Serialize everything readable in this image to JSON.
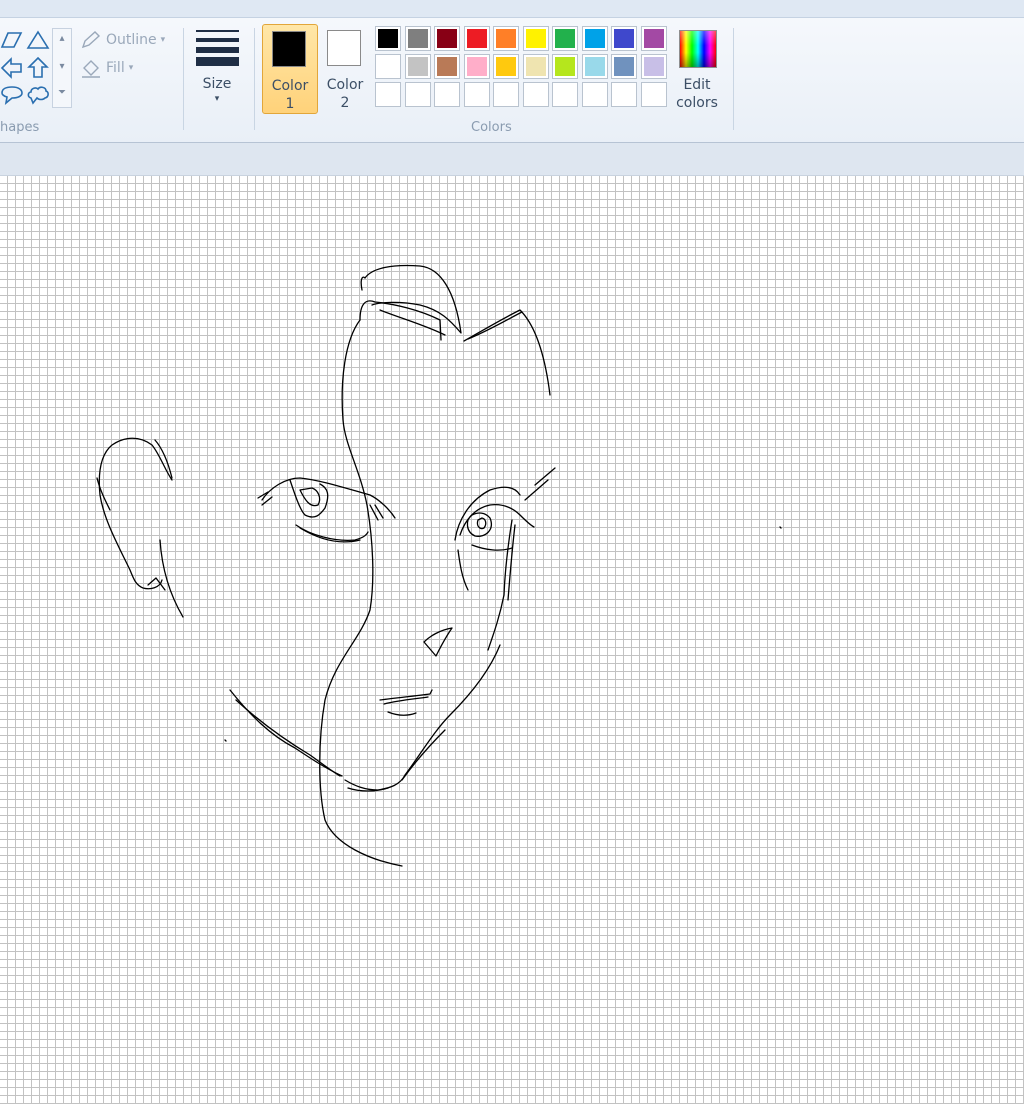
{
  "ribbon": {
    "shapes_group_label": "hapes",
    "outline_label": "Outline",
    "fill_label": "Fill",
    "size_label": "Size",
    "color1_label_line1": "Color",
    "color1_label_line2": "1",
    "color1_value": "#000000",
    "color2_label_line1": "Color",
    "color2_label_line2": "2",
    "color2_value": "#ffffff",
    "colors_group_label": "Colors",
    "edit_colors_line1": "Edit",
    "edit_colors_line2": "colors",
    "palette_row1": [
      "#000000",
      "#7f7f7f",
      "#880015",
      "#ed1c24",
      "#ff7f27",
      "#fff200",
      "#22b14c",
      "#00a2e8",
      "#3f48cc",
      "#a349a4"
    ],
    "palette_row2": [
      "#ffffff",
      "#c3c3c3",
      "#b97a57",
      "#ffaec9",
      "#ffc90e",
      "#efe4b0",
      "#b5e61d",
      "#99d9ea",
      "#7092be",
      "#c8bfe7"
    ],
    "palette_row3": [
      "",
      "",
      "",
      "",
      "",
      "",
      "",
      "",
      "",
      ""
    ]
  },
  "icons": [
    "triangle-shape-icon",
    "polygon-shape-icon",
    "left-arrow-shape-icon",
    "up-arrow-shape-icon",
    "speech-bubble-oval-icon",
    "speech-bubble-cloud-icon",
    "outline-pencil-icon",
    "fill-bucket-icon",
    "size-lines-icon",
    "edit-colors-rainbow-icon"
  ],
  "canvas": {
    "grid": true,
    "content": "freehand sketch of a face"
  }
}
